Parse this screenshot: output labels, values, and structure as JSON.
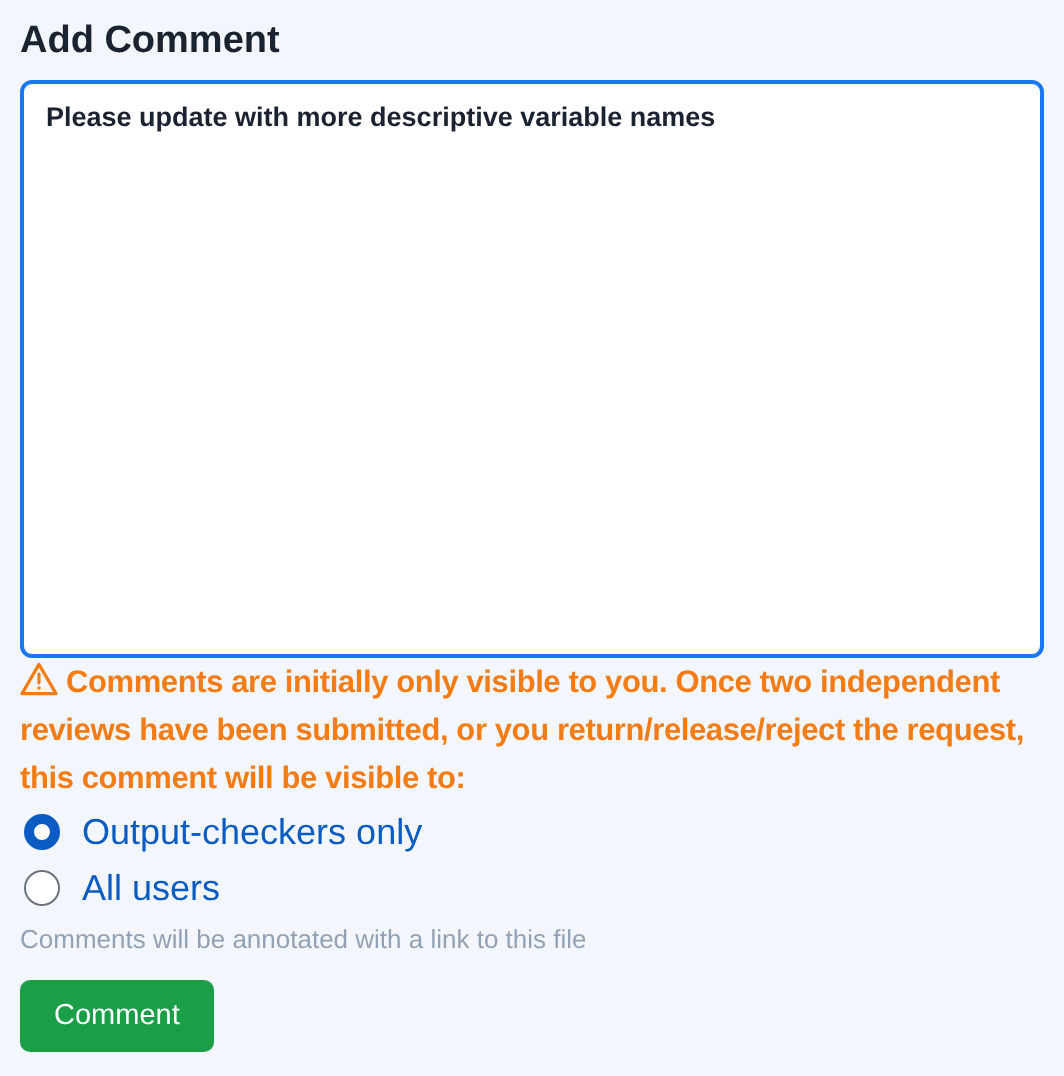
{
  "title": "Add Comment",
  "comment": {
    "value": "Please update with more descriptive variable names"
  },
  "warning": "Comments are initially only visible to you. Once two independent reviews have been submitted, or you return/release/reject the request, this comment will be visible to:",
  "visibility": [
    {
      "label": "Output-checkers only",
      "selected": true
    },
    {
      "label": "All users",
      "selected": false
    }
  ],
  "hint": "Comments will be annotated with a link to this file",
  "button": "Comment"
}
